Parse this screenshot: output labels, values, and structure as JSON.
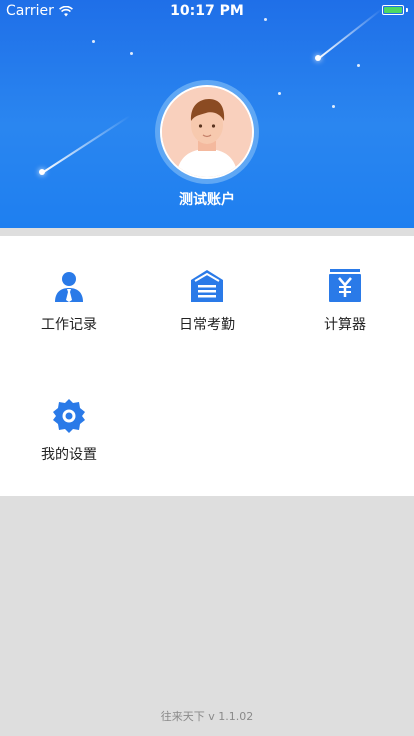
{
  "status_bar": {
    "carrier": "Carrier",
    "time": "10:17 PM",
    "battery_color": "#4cd964"
  },
  "profile": {
    "account_name": "测试账户"
  },
  "menu": {
    "items": [
      {
        "label": "工作记录",
        "icon": "user-tie-icon"
      },
      {
        "label": "日常考勤",
        "icon": "building-icon"
      },
      {
        "label": "计算器",
        "icon": "yen-box-icon"
      },
      {
        "label": "我的设置",
        "icon": "gear-icon"
      }
    ]
  },
  "footer": {
    "version": "往来天下 v 1.1.02"
  },
  "colors": {
    "header": "#2a86f0",
    "icon_blue": "#2a7ae8",
    "background": "#dedede"
  }
}
